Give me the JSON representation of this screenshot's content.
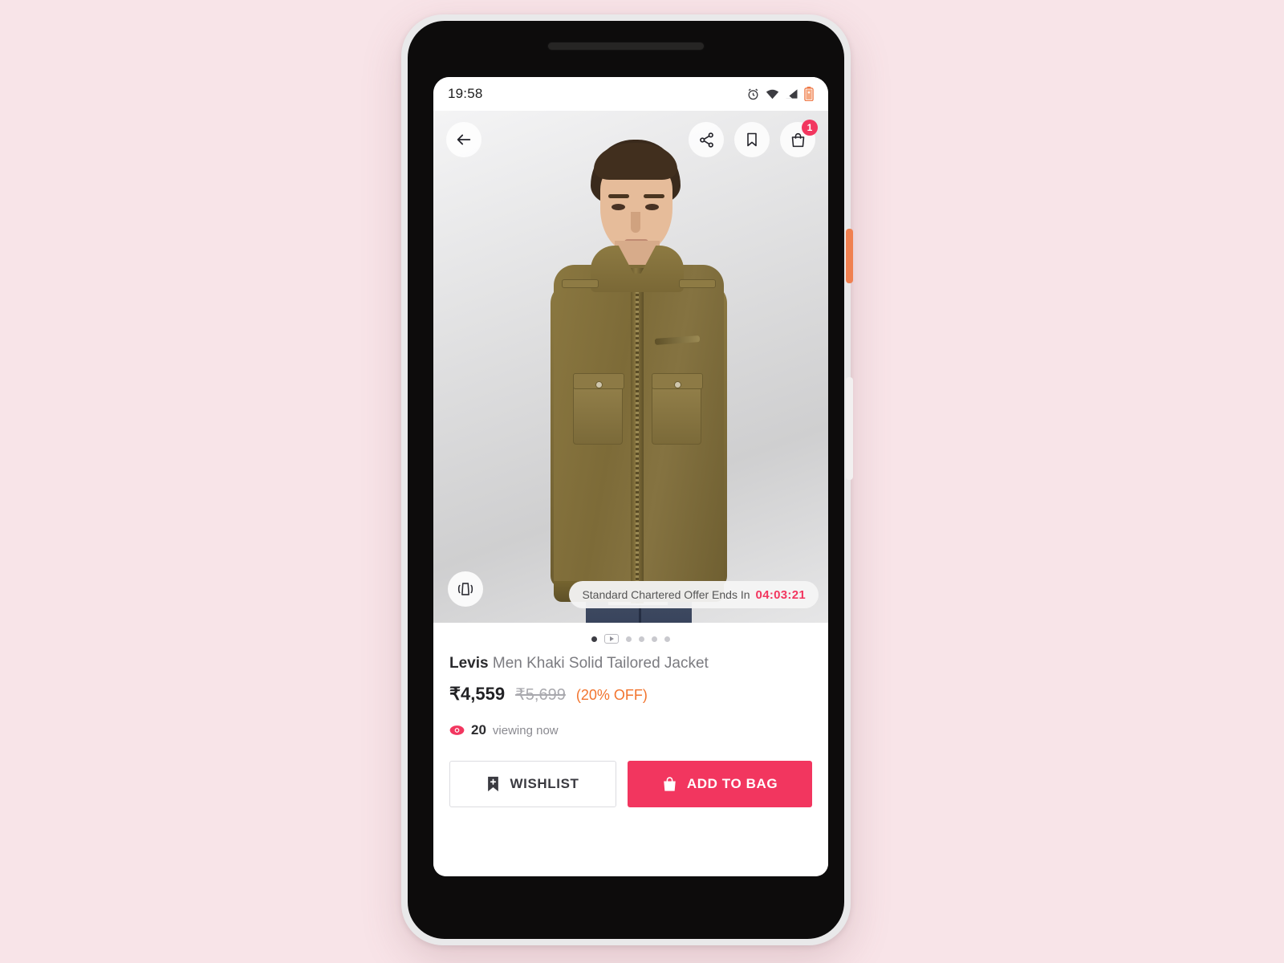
{
  "status_bar": {
    "time": "19:58",
    "icons": [
      "alarm-icon",
      "wifi-icon",
      "signal-icon",
      "battery-charging-icon"
    ]
  },
  "top_bar": {
    "back_icon": "back-arrow-icon",
    "share_icon": "share-icon",
    "bookmark_icon": "bookmark-icon",
    "cart_icon": "shopping-bag-icon",
    "cart_badge": "1"
  },
  "media": {
    "view360_icon": "rotate-360-icon",
    "offer_label": "Standard Chartered Offer Ends In",
    "offer_timer": "04:03:21",
    "pagination": [
      {
        "type": "dot",
        "active": true
      },
      {
        "type": "video",
        "active": false
      },
      {
        "type": "dot",
        "active": false
      },
      {
        "type": "dot",
        "active": false
      },
      {
        "type": "dot",
        "active": false
      },
      {
        "type": "dot",
        "active": false
      }
    ]
  },
  "product": {
    "brand": "Levis",
    "name": " Men Khaki Solid Tailored Jacket",
    "price_current": "₹4,559",
    "price_original": "₹5,699",
    "discount": "(20% OFF)",
    "viewing_count": "20",
    "viewing_label": "viewing now",
    "eye_icon": "eye-icon"
  },
  "actions": {
    "wishlist_label": "WISHLIST",
    "wishlist_icon": "bookmark-plus-icon",
    "addtobag_label": "ADD TO BAG",
    "addtobag_icon": "shopping-bag-icon"
  },
  "colors": {
    "accent": "#f2365f",
    "discount": "#f2742e",
    "background": "#f8e4e8",
    "power_button": "#f08050"
  }
}
